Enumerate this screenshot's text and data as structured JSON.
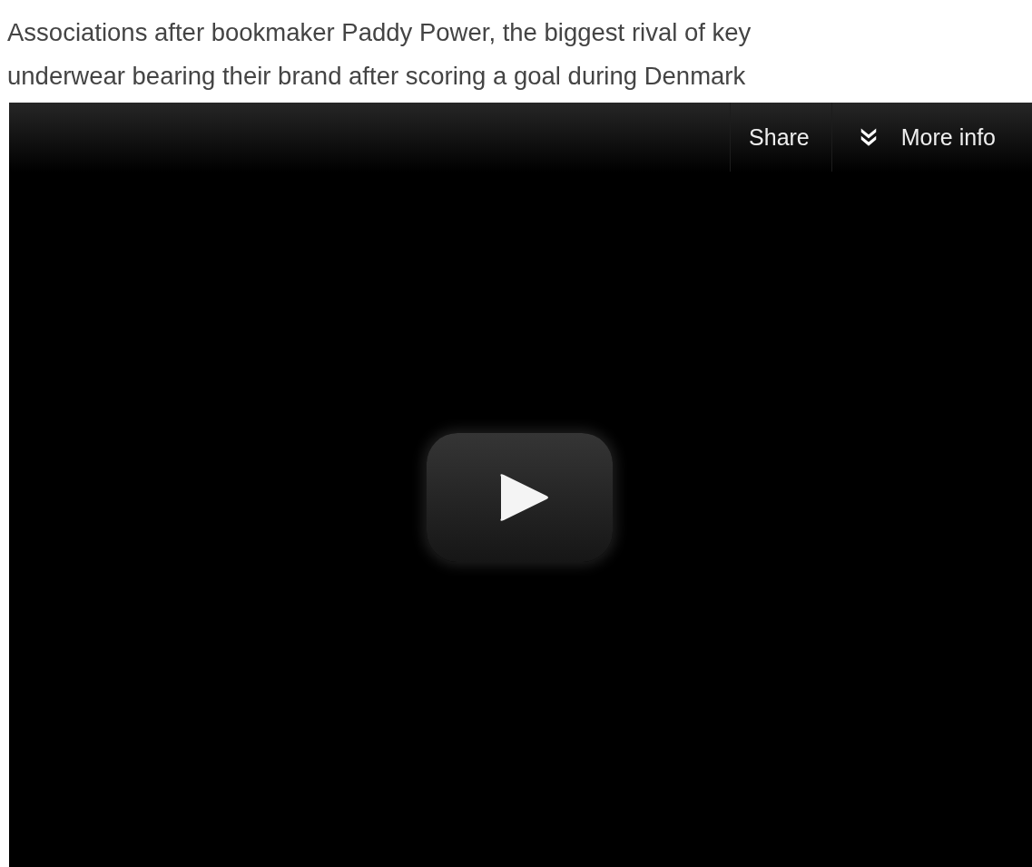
{
  "article": {
    "lines": [
      "Associations after bookmaker Paddy Power, the biggest rival of key",
      "underwear bearing their brand after scoring a goal during Denmark"
    ]
  },
  "video": {
    "controls": [
      {
        "kind": "share",
        "label": "Share"
      },
      {
        "kind": "more",
        "label": "More info"
      }
    ]
  }
}
